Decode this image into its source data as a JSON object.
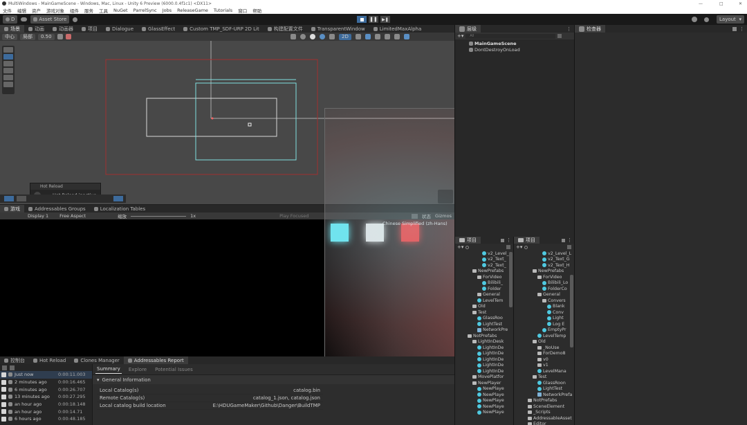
{
  "window": {
    "title": "MultiWindows - MainGameScene - Windows, Mac, Linux - Unity 6 Preview (6000.0.4f1c1) <DX11>",
    "controls": [
      "—",
      "□",
      "✕"
    ]
  },
  "menu": [
    "文件",
    "编辑",
    "资产",
    "游戏对象",
    "组件",
    "服务",
    "工具",
    "NuGet",
    "ParrelSync",
    "Jobs",
    "ReleaseGame",
    "Tutorials",
    "窗口",
    "帮助"
  ],
  "toolbar": {
    "account": "D",
    "asset_store": "Asset Store",
    "layout": "Layout"
  },
  "scene_tabs": [
    "场景",
    "动画",
    "动画器",
    "项目",
    "Dialogue",
    "GlassEffect",
    "Custom TMP_SDF-URP 2D Lit",
    "构建配置文件",
    "TransparentWindow",
    "LimitedMaxAlpha"
  ],
  "scene_toolbar": {
    "pivot": "中心",
    "space": "局部",
    "snap": "0.50",
    "mode_2d": "2D"
  },
  "hierarchy": {
    "tab": "层级",
    "search_placeholder": "All",
    "items": [
      "MainGameScene",
      "DontDestroyOnLoad"
    ]
  },
  "inspector": {
    "tab": "检查器"
  },
  "hot_reload": {
    "header": "Hot Reload",
    "status": "Hot Reload inactive"
  },
  "game_tabs": [
    "游戏",
    "Addressables Groups",
    "Localization Tables"
  ],
  "game_toolbar": {
    "display": "Display 1",
    "aspect": "Free Aspect",
    "scale_label": "缩放",
    "scale_value": "1x",
    "play_mode": "Play Focused",
    "stats": "状态",
    "gizmos": "Gizmos",
    "overlay_text": "Chinese Simplified (zh-Hans)"
  },
  "game_squares": [
    {
      "name": "cyan",
      "color": "#5ff3ff"
    },
    {
      "name": "white",
      "color": "#f2f2f2"
    },
    {
      "name": "red",
      "color": "#ff3b3b"
    }
  ],
  "bottom_tabs": [
    "控制台",
    "Hot Reload",
    "Clones Manager",
    "Addressables Report"
  ],
  "console_rows": [
    {
      "time": "Just now",
      "duration": "0:00:11.003"
    },
    {
      "time": "2 minutes ago",
      "duration": "0:00:16.465"
    },
    {
      "time": "6 minutes ago",
      "duration": "0:00:26.707"
    },
    {
      "time": "13 minutes ago",
      "duration": "0:00:27.295"
    },
    {
      "time": "an hour ago",
      "duration": "0:00:18.148"
    },
    {
      "time": "an hour ago",
      "duration": "0:00:14.71"
    },
    {
      "time": "6 hours ago",
      "duration": "0:00:48.185"
    }
  ],
  "report": {
    "tabs": [
      "Summary",
      "Explore",
      "Potential Issues"
    ],
    "section": "General Information",
    "rows": [
      {
        "key": "Local Catalog(s)",
        "value": "catalog.bin"
      },
      {
        "key": "Remote Catalog(s)",
        "value": "catalog_1.json, catalog.json"
      },
      {
        "key": "Local catalog build location",
        "value": "E:\\HDUGameMaker\\Github\\Danger\\BuildTMP"
      }
    ]
  },
  "project_left": {
    "tab": "项目",
    "items": [
      {
        "label": "v2_Level_",
        "indent": 3,
        "icon": "cyan"
      },
      {
        "label": "v2_Text_",
        "indent": 3,
        "icon": "cyan"
      },
      {
        "label": "v2_Text_",
        "indent": 3,
        "icon": "cyan"
      },
      {
        "label": "NewPrefabs",
        "indent": 1,
        "icon": "folder"
      },
      {
        "label": "ForVideo",
        "indent": 2,
        "icon": "folder"
      },
      {
        "label": "Bilibili_",
        "indent": 3,
        "icon": "cyan"
      },
      {
        "label": "Folder",
        "indent": 3,
        "icon": "cyan"
      },
      {
        "label": "General",
        "indent": 2,
        "icon": "folder"
      },
      {
        "label": "LevelTem",
        "indent": 2,
        "icon": "cyan"
      },
      {
        "label": "Old",
        "indent": 1,
        "icon": "folder"
      },
      {
        "label": "Test",
        "indent": 1,
        "icon": "folder"
      },
      {
        "label": "GlassRoo",
        "indent": 2,
        "icon": "cyan"
      },
      {
        "label": "LightTest",
        "indent": 2,
        "icon": "cyan"
      },
      {
        "label": "NetworkPre",
        "indent": 2,
        "icon": "cube"
      },
      {
        "label": "NotPrefabs",
        "indent": 0,
        "icon": "folder"
      },
      {
        "label": "LightInDesk",
        "indent": 1,
        "icon": "folder"
      },
      {
        "label": "LightInDe",
        "indent": 2,
        "icon": "cyan"
      },
      {
        "label": "LightInDe",
        "indent": 2,
        "icon": "cyan"
      },
      {
        "label": "LightInDe",
        "indent": 2,
        "icon": "cyan"
      },
      {
        "label": "LightInDe",
        "indent": 2,
        "icon": "cyan"
      },
      {
        "label": "LightInDe",
        "indent": 2,
        "icon": "cyan"
      },
      {
        "label": "MovePlatfor",
        "indent": 1,
        "icon": "folder"
      },
      {
        "label": "NewPlayer",
        "indent": 1,
        "icon": "folder"
      },
      {
        "label": "NewPlaye",
        "indent": 2,
        "icon": "cyan"
      },
      {
        "label": "NewPlaye",
        "indent": 2,
        "icon": "cyan"
      },
      {
        "label": "NewPlaye",
        "indent": 2,
        "icon": "cyan"
      },
      {
        "label": "NewPlaye",
        "indent": 2,
        "icon": "cyan"
      },
      {
        "label": "NewPlaye",
        "indent": 2,
        "icon": "cyan"
      }
    ]
  },
  "project_right": {
    "tab": "项目",
    "items": [
      {
        "label": "v2_Level_L",
        "indent": 3,
        "icon": "cyan"
      },
      {
        "label": "v2_Text_G",
        "indent": 3,
        "icon": "cyan"
      },
      {
        "label": "v2_Text_H",
        "indent": 3,
        "icon": "cyan"
      },
      {
        "label": "NewPrefabs",
        "indent": 1,
        "icon": "folder"
      },
      {
        "label": "ForVideo",
        "indent": 2,
        "icon": "folder"
      },
      {
        "label": "Bilibili_Lo",
        "indent": 3,
        "icon": "cyan"
      },
      {
        "label": "FolderCo",
        "indent": 3,
        "icon": "cyan"
      },
      {
        "label": "General",
        "indent": 2,
        "icon": "folder"
      },
      {
        "label": "Convers",
        "indent": 3,
        "icon": "folder"
      },
      {
        "label": "Blank",
        "indent": 4,
        "icon": "cyan"
      },
      {
        "label": "Conv",
        "indent": 4,
        "icon": "cyan"
      },
      {
        "label": "Light",
        "indent": 4,
        "icon": "cyan"
      },
      {
        "label": "Log E",
        "indent": 4,
        "icon": "cyan"
      },
      {
        "label": "EmptyPr",
        "indent": 3,
        "icon": "cyan"
      },
      {
        "label": "LevelTemp",
        "indent": 2,
        "icon": "cyan"
      },
      {
        "label": "Old",
        "indent": 1,
        "icon": "folder"
      },
      {
        "label": "_NoUse",
        "indent": 2,
        "icon": "folder"
      },
      {
        "label": "ForDemo8",
        "indent": 2,
        "icon": "folder"
      },
      {
        "label": "v0",
        "indent": 2,
        "icon": "folder"
      },
      {
        "label": "v1",
        "indent": 2,
        "icon": "folder"
      },
      {
        "label": "LevelMana",
        "indent": 2,
        "icon": "cyan"
      },
      {
        "label": "Test",
        "indent": 1,
        "icon": "folder"
      },
      {
        "label": "GlassRoon",
        "indent": 2,
        "icon": "cyan"
      },
      {
        "label": "LightTest",
        "indent": 2,
        "icon": "cyan"
      },
      {
        "label": "NetworkPrefa",
        "indent": 2,
        "icon": "cube"
      },
      {
        "label": "NotPrefabs",
        "indent": 0,
        "icon": "folder"
      },
      {
        "label": "SceneElement",
        "indent": 0,
        "icon": "folder"
      },
      {
        "label": "_Scripts",
        "indent": -1,
        "icon": "folder"
      },
      {
        "label": "AddressableAsset",
        "indent": -1,
        "icon": "folder"
      },
      {
        "label": "Editor",
        "indent": -1,
        "icon": "folder"
      }
    ]
  }
}
